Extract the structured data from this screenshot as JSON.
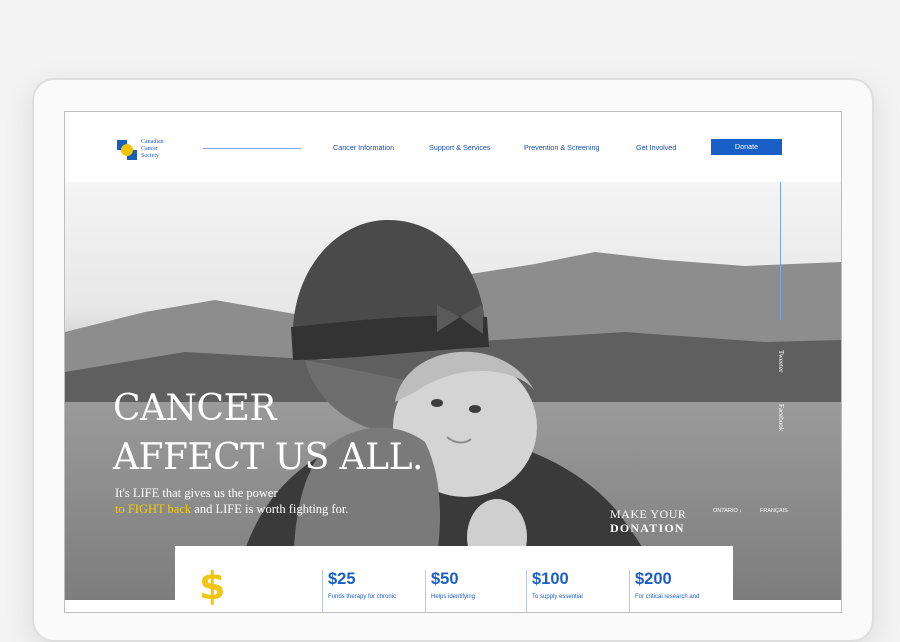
{
  "logo": {
    "line1": "Canadian",
    "line2": "Cancer",
    "line3": "Society"
  },
  "nav": {
    "items": [
      {
        "label": "Cancer Information"
      },
      {
        "label": "Support & Services"
      },
      {
        "label": "Prevention & Screening"
      },
      {
        "label": "Get Involved"
      }
    ],
    "donate_label": "Donate"
  },
  "social": {
    "twitter": "Tweeter",
    "facebook": "Facebook"
  },
  "hero": {
    "headline_line1": "CANCER",
    "headline_line2": "AFFECT US ALL.",
    "tagline_line1": "It's LIFE that gives us the power",
    "tagline_highlight": "to FIGHT back",
    "tagline_rest": " and LIFE is worth fighting for.",
    "make_donation_line1": "MAKE YOUR",
    "make_donation_line2": "DONATION",
    "region_label": "ONTARIO ↓",
    "language_label": "FRANÇAIS"
  },
  "donation": {
    "symbol": "$",
    "tiers": [
      {
        "amount": "$25",
        "desc": "Funds therapy for chronic"
      },
      {
        "amount": "$50",
        "desc": "Helps identifying"
      },
      {
        "amount": "$100",
        "desc": "To supply essential"
      },
      {
        "amount": "$200",
        "desc": "For critical research and"
      }
    ]
  },
  "colors": {
    "brand_blue": "#1a5fc7",
    "accent_yellow": "#f2cc14"
  }
}
